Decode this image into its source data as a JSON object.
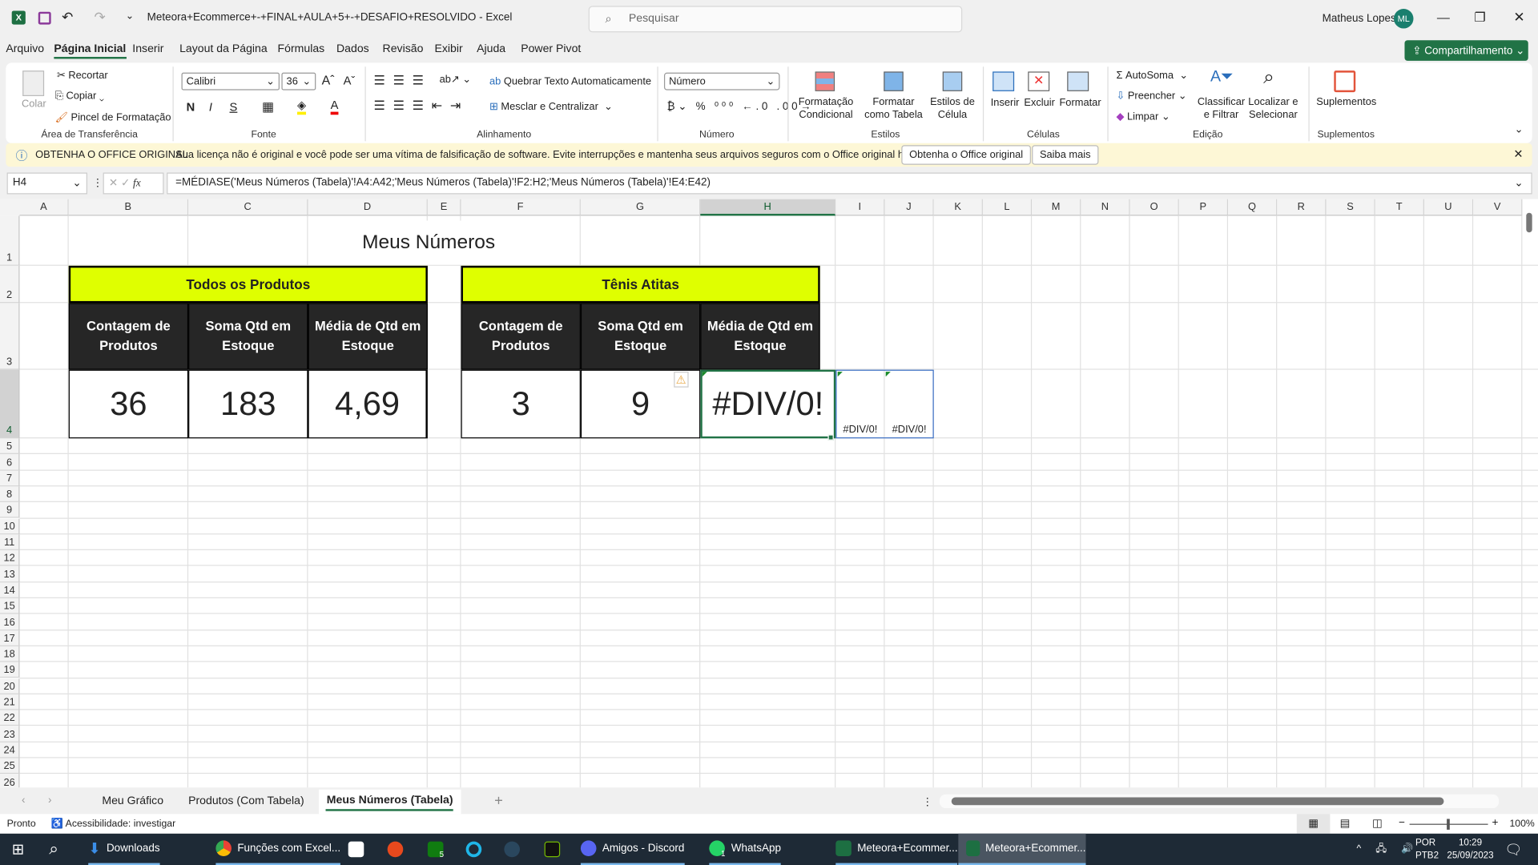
{
  "window": {
    "title": "Meteora+Ecommerce+-+FINAL+AULA+5+-+DESAFIO+RESOLVIDO  -  Excel",
    "search_placeholder": "Pesquisar",
    "user": "Matheus Lopes",
    "initials": "ML"
  },
  "menu": [
    "Arquivo",
    "Página Inicial",
    "Inserir",
    "Layout da Página",
    "Fórmulas",
    "Dados",
    "Revisão",
    "Exibir",
    "Ajuda",
    "Power Pivot"
  ],
  "share": "Compartilhamento",
  "ribbon": {
    "clipboard": {
      "paste": "Colar",
      "cut": "Recortar",
      "copy": "Copiar",
      "painter": "Pincel de Formatação",
      "label": "Área de Transferência"
    },
    "font": {
      "name": "Calibri",
      "size": "36",
      "bold": "N",
      "italic": "I",
      "underline": "S",
      "label": "Fonte"
    },
    "alignment": {
      "wrap": "Quebrar Texto Automaticamente",
      "merge": "Mesclar e Centralizar",
      "label": "Alinhamento"
    },
    "number": {
      "format": "Número",
      "label": "Número"
    },
    "styles": {
      "conditional": "Formatação Condicional",
      "table": "Formatar como Tabela",
      "cell": "Estilos de Célula",
      "label": "Estilos"
    },
    "cells": {
      "insert": "Inserir",
      "delete": "Excluir",
      "format": "Formatar",
      "label": "Células"
    },
    "editing": {
      "autosum": "AutoSoma",
      "fill": "Preencher",
      "clear": "Limpar",
      "sort": "Classificar e Filtrar",
      "find": "Localizar e Selecionar",
      "label": "Edição"
    },
    "addins": {
      "addins": "Suplementos",
      "label": "Suplementos"
    }
  },
  "infobar": {
    "title": "OBTENHA O OFFICE ORIGINAL",
    "message": "Sua licença não é original e você pode ser uma vítima de falsificação de software. Evite interrupções e mantenha seus arquivos seguros com o Office original hoje mesmo.",
    "button1": "Obtenha o Office original",
    "button2": "Saiba mais"
  },
  "formula_bar": {
    "name_box": "H4",
    "fx": "fx",
    "formula": "=MÉDIASE('Meus Números (Tabela)'!A4:A42;'Meus Números (Tabela)'!F2:H2;'Meus Números (Tabela)'!E4:E42)"
  },
  "columns": [
    "A",
    "B",
    "C",
    "D",
    "E",
    "F",
    "G",
    "H",
    "I",
    "J",
    "K",
    "L",
    "M",
    "N",
    "O",
    "P",
    "Q",
    "R",
    "S",
    "T",
    "U",
    "V"
  ],
  "rows": [
    "1",
    "2",
    "3",
    "4",
    "5",
    "6",
    "7",
    "8",
    "9",
    "10",
    "11",
    "12",
    "13",
    "14",
    "15",
    "16",
    "17",
    "18",
    "19",
    "20",
    "21",
    "22",
    "23",
    "24",
    "25",
    "26"
  ],
  "sheet": {
    "title": "Meus Números",
    "table1": {
      "header": "Todos os Produtos",
      "cols": [
        "Contagem de Produtos",
        "Soma Qtd em Estoque",
        "Média de Qtd em Estoque"
      ],
      "values": [
        "36",
        "183",
        "4,69"
      ]
    },
    "table2": {
      "header": "Tênis Atitas",
      "cols": [
        "Contagem de Produtos",
        "Soma Qtd em Estoque",
        "Média de Qtd em Estoque"
      ],
      "values": [
        "3",
        "9",
        "#DIV/0!"
      ]
    },
    "spill": [
      "#DIV/0!",
      "#DIV/0!"
    ]
  },
  "sheet_tabs": [
    "Meu Gráfico",
    "Produtos (Com Tabela)",
    "Meus Números (Tabela)"
  ],
  "active_tab": "Meus Números (Tabela)",
  "status": {
    "ready": "Pronto",
    "accessibility": "Acessibilidade: investigar",
    "zoom": "100%"
  },
  "taskbar": {
    "items": [
      "Downloads",
      "Funções com Excel...",
      "Amigos - Discord",
      "WhatsApp",
      "Meteora+Ecommer...",
      "Meteora+Ecommer..."
    ],
    "lang1": "POR",
    "lang2": "PTB2",
    "time": "10:29",
    "date": "25/09/2023",
    "xbox_badge": "5",
    "whatsapp_badge": "1"
  },
  "colors": {
    "excel_green": "#217346",
    "header_yellow": "#dfff00",
    "header_dark": "#262626",
    "info_bg": "#fdf7d6",
    "taskbar": "#1e2a36"
  }
}
